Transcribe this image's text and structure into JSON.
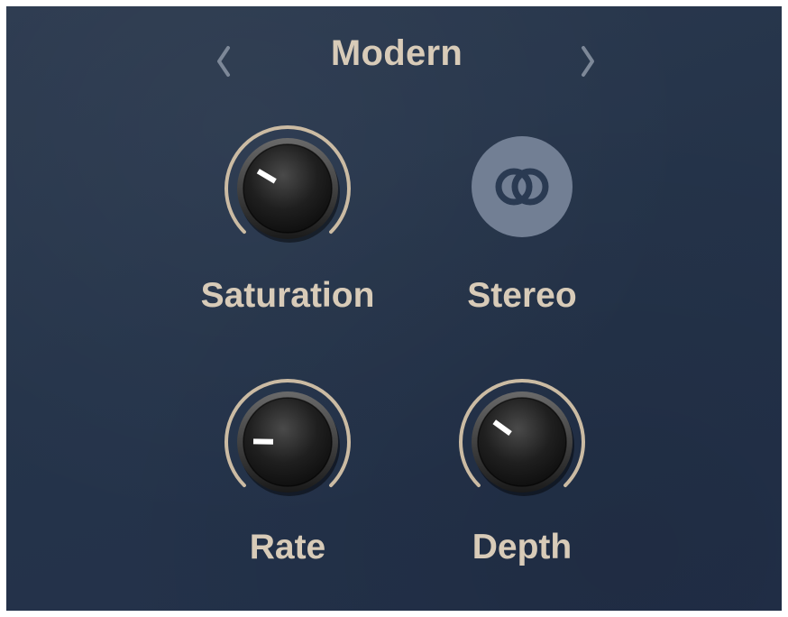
{
  "preset": {
    "name": "Modern",
    "prev_icon": "chevron-left-icon",
    "next_icon": "chevron-right-icon"
  },
  "controls": {
    "saturation": {
      "label": "Saturation",
      "value": 0.28
    },
    "stereo": {
      "label": "Stereo",
      "icon": "stereo-rings-icon"
    },
    "rate": {
      "label": "Rate",
      "value": 0.17
    },
    "depth": {
      "label": "Depth",
      "value": 0.3
    }
  },
  "colors": {
    "background": "#25344a",
    "label": "#d8cbb8",
    "ring": "#cbbba3",
    "arrow": "#7d8898",
    "stereo_button": "#727f94",
    "stereo_icon": "#2a3a52"
  }
}
